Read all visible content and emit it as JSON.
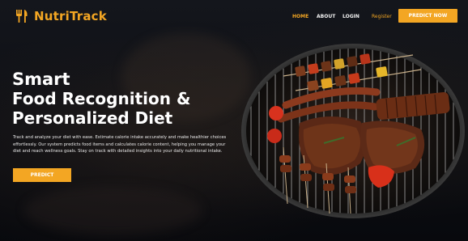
{
  "brand": {
    "name": "NutriTrack",
    "icon": "fork-knife-icon",
    "accent": "#f3a623"
  },
  "nav": {
    "home": "HOME",
    "about": "ABOUT",
    "login": "LOGIN",
    "register": "Register",
    "cta": "PREDICT NOW"
  },
  "hero": {
    "title_line1": "Smart",
    "title_line2": "Food Recognition &",
    "title_line3": "Personalized Diet",
    "description": "Track and analyze your diet with ease. Estimate calorie intake accurately and make healthier choices effortlessly. Our system predicts food items and calculates calorie content, helping you manage your diet and reach wellness goals. Stay on track with detailed insights into your daily nutritional intake.",
    "button": "PREDICT"
  },
  "image": {
    "subject": "grill-with-steaks-sausages-and-skewers"
  }
}
